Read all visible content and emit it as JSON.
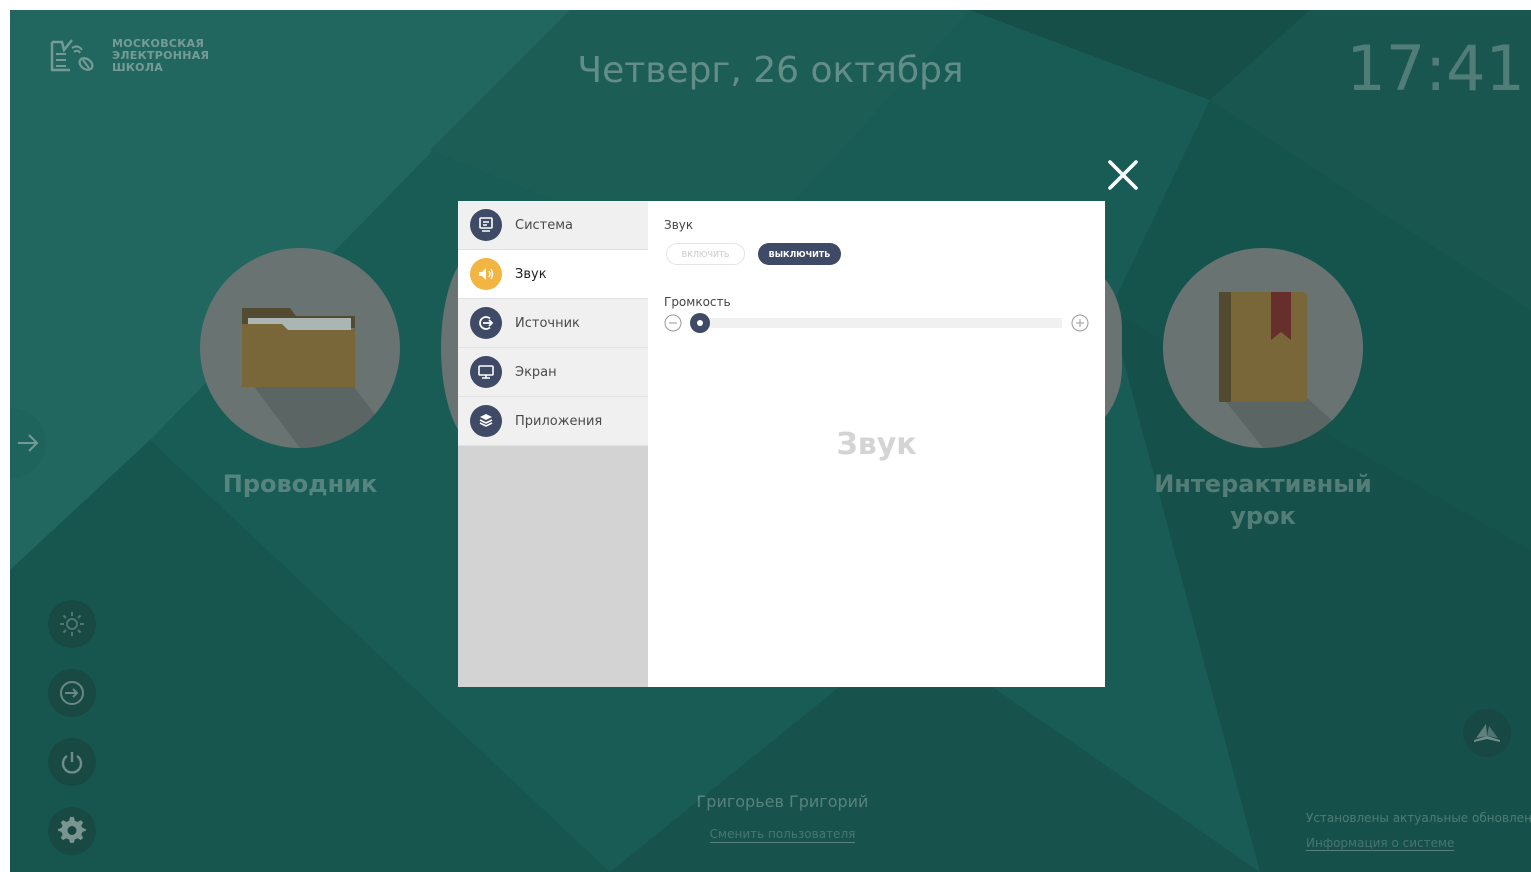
{
  "logo": {
    "lines": [
      "МОСКОВСКАЯ",
      "ЭЛЕКТРОННАЯ",
      "ШКОЛА"
    ]
  },
  "header": {
    "date": "Четверг, 26 октября",
    "time": "17:41"
  },
  "tiles": [
    {
      "label": "Проводник",
      "icon": "folder-icon"
    },
    {
      "label": "Интерактивный урок",
      "label_lines": [
        "Интерактивный",
        "урок"
      ],
      "icon": "book-icon"
    }
  ],
  "side_buttons": [
    "brightness-icon",
    "login-icon",
    "power-icon",
    "gear-icon"
  ],
  "footer": {
    "user_name": "Григорьев Григорий",
    "switch_user": "Сменить пользователя",
    "updates_status": "Установлены актуальные обновления",
    "system_info": "Информация о системе"
  },
  "dialog": {
    "menu": [
      {
        "label": "Система",
        "icon": "monitor-settings-icon",
        "active": false
      },
      {
        "label": "Звук",
        "icon": "speaker-icon",
        "active": true
      },
      {
        "label": "Источник",
        "icon": "source-icon",
        "active": false
      },
      {
        "label": "Экран",
        "icon": "screen-icon",
        "active": false
      },
      {
        "label": "Приложения",
        "icon": "apps-icon",
        "active": false
      }
    ],
    "sound": {
      "title": "Звук",
      "on_label": "включить",
      "off_label": "выключить",
      "volume_label": "Громкость",
      "volume_level": 0,
      "watermark": "Звук"
    }
  },
  "colors": {
    "accent": "#3f4a66",
    "active_icon": "#f2b541",
    "background": "#1f6d64"
  }
}
